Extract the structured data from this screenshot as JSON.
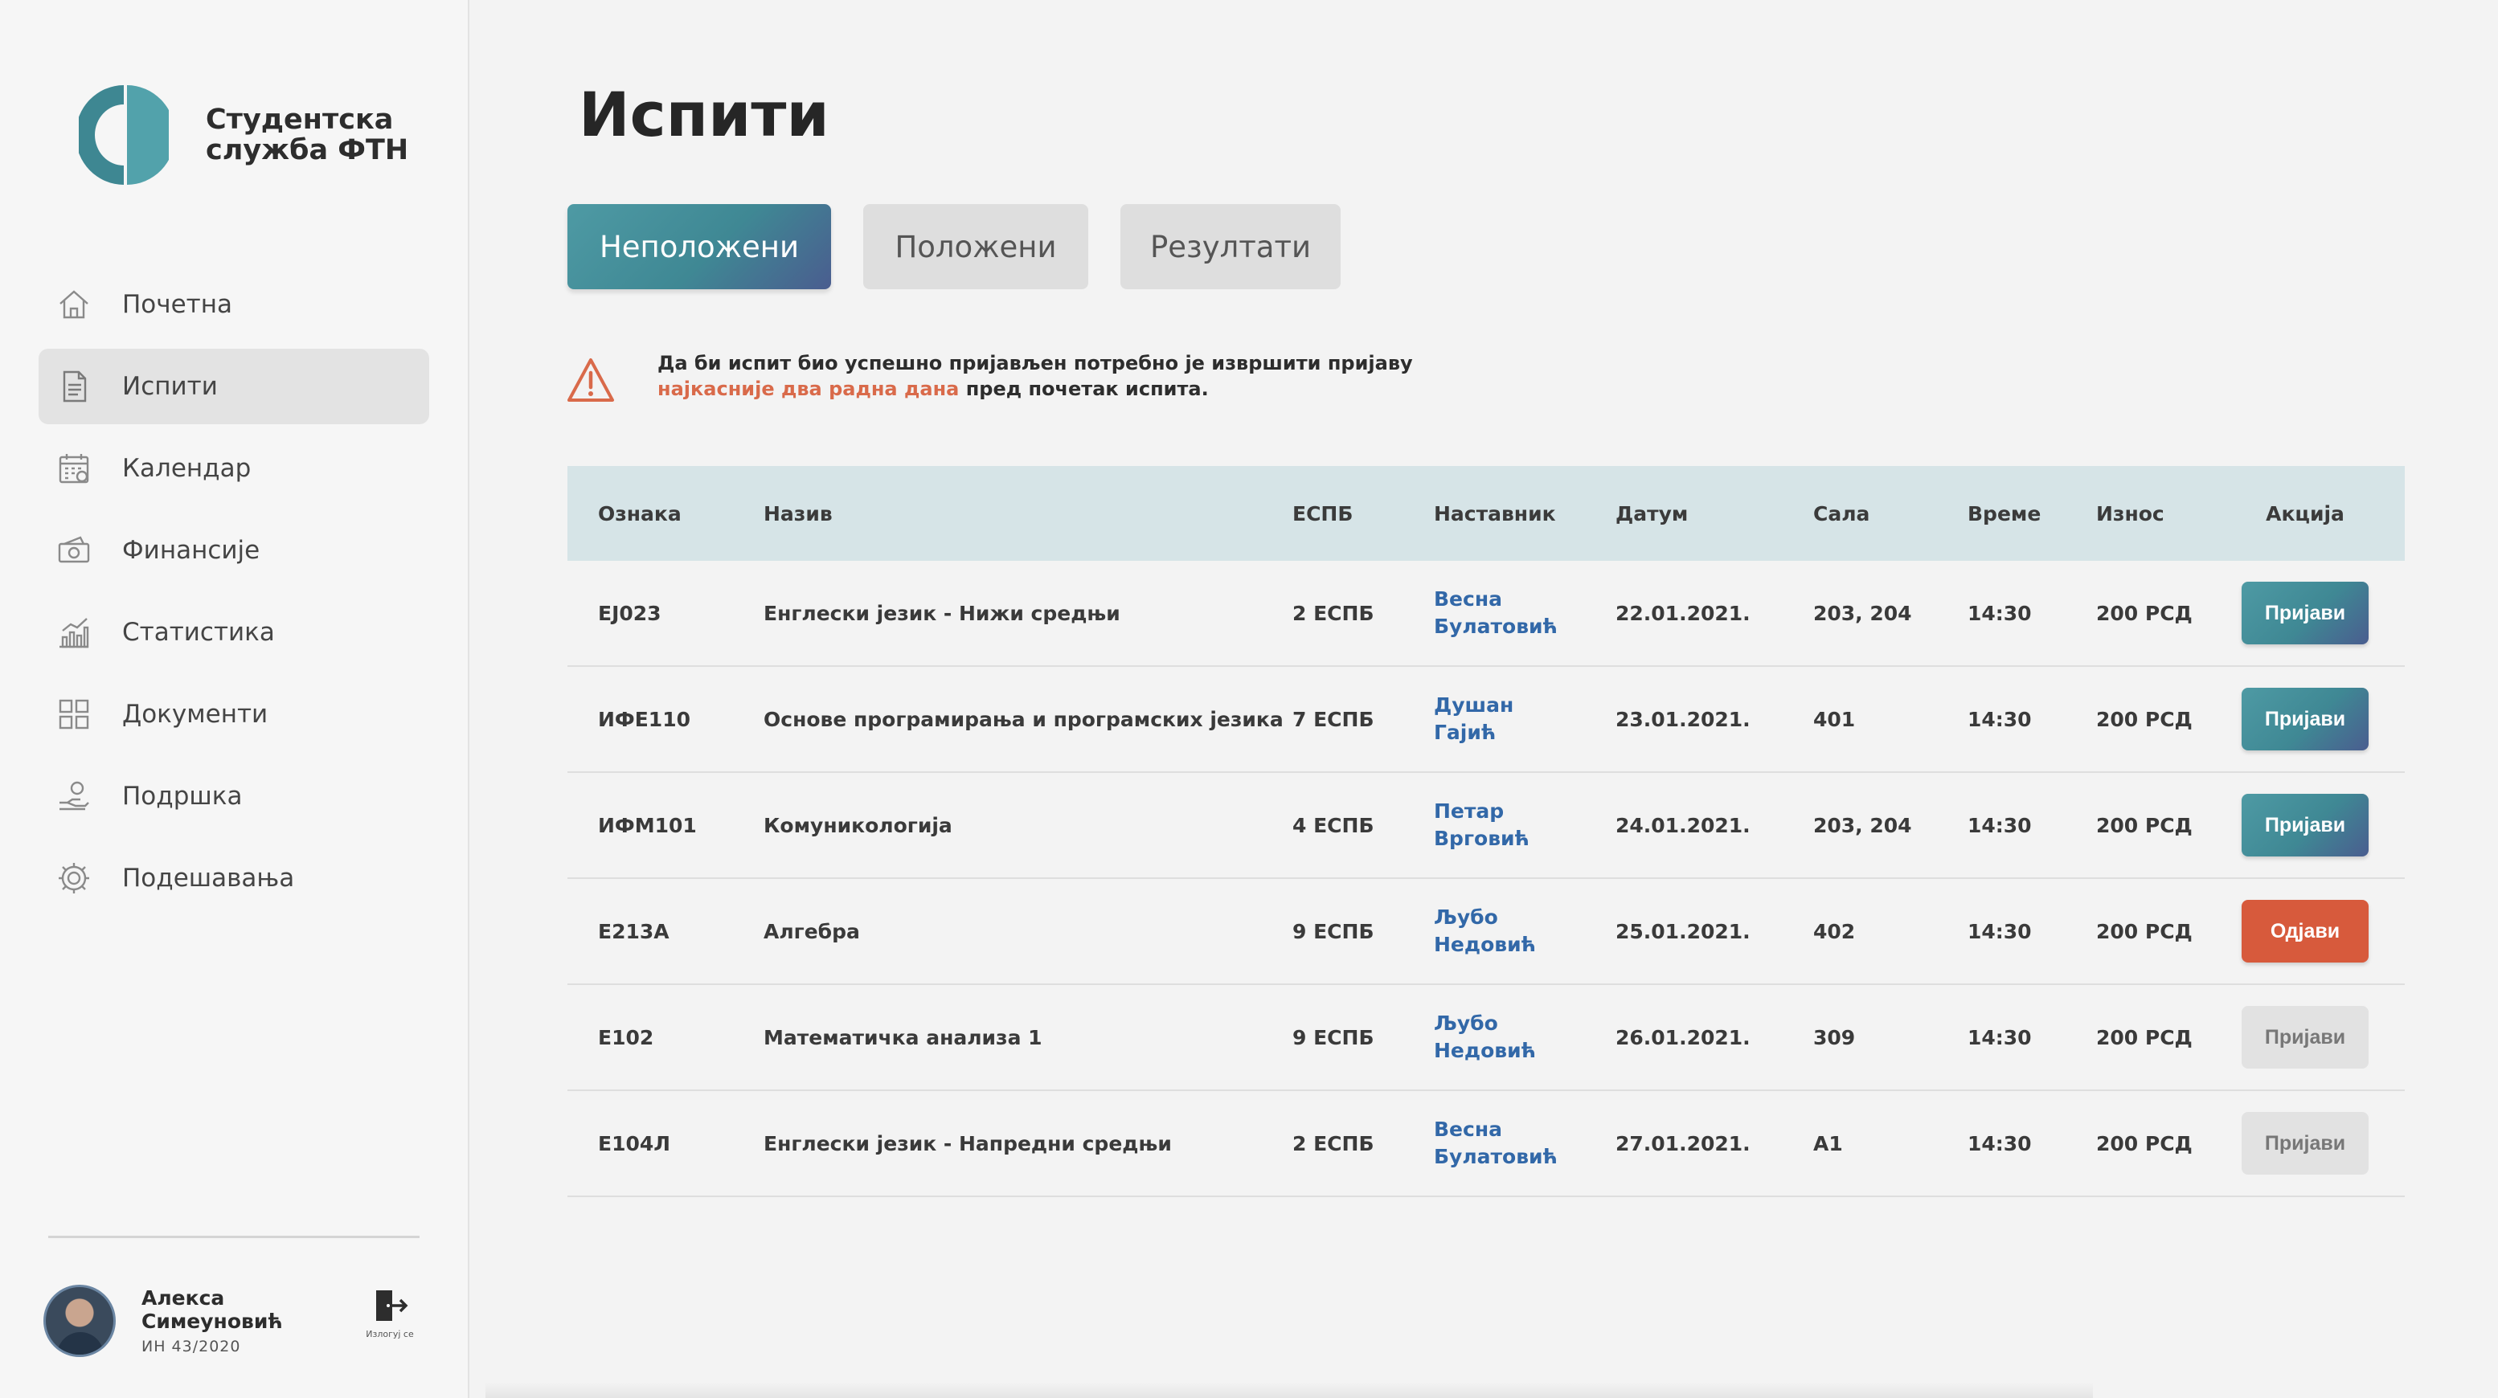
{
  "brand": {
    "line1": "Студентска",
    "line2": "служба ФТН"
  },
  "sidebar": {
    "items": [
      {
        "label": "Почетна",
        "icon": "home-icon"
      },
      {
        "label": "Испити",
        "icon": "document-icon",
        "active": true
      },
      {
        "label": "Календар",
        "icon": "calendar-icon"
      },
      {
        "label": "Финансије",
        "icon": "money-icon"
      },
      {
        "label": "Статистика",
        "icon": "chart-icon"
      },
      {
        "label": "Документи",
        "icon": "grid-icon"
      },
      {
        "label": "Подршка",
        "icon": "support-icon"
      },
      {
        "label": "Подешавања",
        "icon": "gear-icon"
      }
    ]
  },
  "user": {
    "first": "Алекса",
    "last": "Симеуновић",
    "id": "ИН 43/2020",
    "logout_label": "Излогуј се"
  },
  "page": {
    "title": "Испити"
  },
  "tabs": [
    {
      "label": "Неположени",
      "active": true
    },
    {
      "label": "Положени"
    },
    {
      "label": "Резултати"
    }
  ],
  "notice": {
    "part1": "Да би испит био успешно пријављен потребно је извршити пријаву",
    "highlight": "најкасније два радна дана",
    "part2": " пред почетак испита."
  },
  "table": {
    "headers": [
      "Ознака",
      "Назив",
      "ЕСПБ",
      "Наставник",
      "Датум",
      "Сала",
      "Време",
      "Износ",
      "Акција"
    ],
    "rows": [
      {
        "code": "ЕЈ023",
        "name": "Енглески језик - Нижи средњи",
        "ects": "2 ЕСПБ",
        "teacher": "Весна\nБулатовић",
        "date": "22.01.2021.",
        "room": "203, 204",
        "time": "14:30",
        "amount": "200 РСД",
        "action": "Пријави",
        "action_state": "primary"
      },
      {
        "code": "ИФЕ110",
        "name": "Основе програмирања и програмских језика",
        "ects": "7 ЕСПБ",
        "teacher": "Душан\nГајић",
        "date": "23.01.2021.",
        "room": "401",
        "time": "14:30",
        "amount": "200 РСД",
        "action": "Пријави",
        "action_state": "primary"
      },
      {
        "code": "ИФМ101",
        "name": "Комуникологија",
        "ects": "4 ЕСПБ",
        "teacher": "Петар\nВрговић",
        "date": "24.01.2021.",
        "room": "203, 204",
        "time": "14:30",
        "amount": "200 РСД",
        "action": "Пријави",
        "action_state": "primary"
      },
      {
        "code": "Е213А",
        "name": "Алгебра",
        "ects": "9 ЕСПБ",
        "teacher": "Љубо\nНедовић",
        "date": "25.01.2021.",
        "room": "402",
        "time": "14:30",
        "amount": "200 РСД",
        "action": "Одјави",
        "action_state": "danger"
      },
      {
        "code": "Е102",
        "name": "Математичка анализа 1",
        "ects": "9 ЕСПБ",
        "teacher": "Љубо\nНедовић",
        "date": "26.01.2021.",
        "room": "309",
        "time": "14:30",
        "amount": "200 РСД",
        "action": "Пријави",
        "action_state": "disabled"
      },
      {
        "code": "Е104Л",
        "name": "Енглески језик - Напредни средњи",
        "ects": "2 ЕСПБ",
        "teacher": "Весна\nБулатовић",
        "date": "27.01.2021.",
        "room": "А1",
        "time": "14:30",
        "amount": "200 РСД",
        "action": "Пријави",
        "action_state": "disabled"
      }
    ]
  },
  "colors": {
    "accent": "#3f8894",
    "danger": "#d75a3c",
    "link": "#3268a8",
    "warning": "#d96a4a",
    "header_bg": "#d6e4e7"
  }
}
